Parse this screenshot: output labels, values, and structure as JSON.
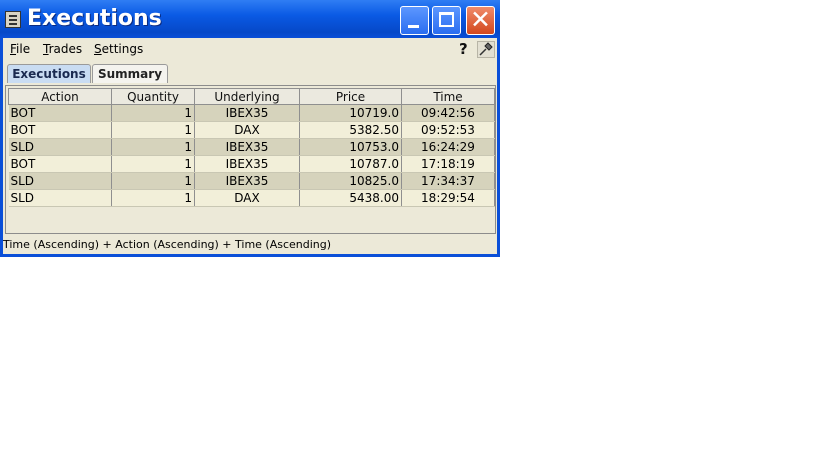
{
  "window": {
    "title": "Executions",
    "controls": {
      "minimize": "minimize",
      "maximize": "maximize",
      "close": "✕"
    }
  },
  "menubar": {
    "items": [
      "File",
      "Trades",
      "Settings"
    ],
    "help": "?"
  },
  "tabs": [
    {
      "label": "Executions",
      "active": true
    },
    {
      "label": "Summary",
      "active": false
    }
  ],
  "table": {
    "columns": [
      "Action",
      "Quantity",
      "Underlying",
      "Price",
      "Time"
    ],
    "rows": [
      [
        "BOT",
        "1",
        "IBEX35",
        "10719.0",
        "09:42:56"
      ],
      [
        "BOT",
        "1",
        "DAX",
        "5382.50",
        "09:52:53"
      ],
      [
        "SLD",
        "1",
        "IBEX35",
        "10753.0",
        "16:24:29"
      ],
      [
        "BOT",
        "1",
        "IBEX35",
        "10787.0",
        "17:18:19"
      ],
      [
        "SLD",
        "1",
        "IBEX35",
        "10825.0",
        "17:34:37"
      ],
      [
        "SLD",
        "1",
        "DAX",
        "5438.00",
        "18:29:54"
      ]
    ]
  },
  "status": {
    "sort": "Time (Ascending)  +  Action (Ascending)  +  Time (Ascending)"
  },
  "colors": {
    "titlebar": "#0a4fd8",
    "row_odd": "#d6d3bc",
    "row_even": "#f2efd9",
    "active_tab": "#c9dcf2"
  }
}
